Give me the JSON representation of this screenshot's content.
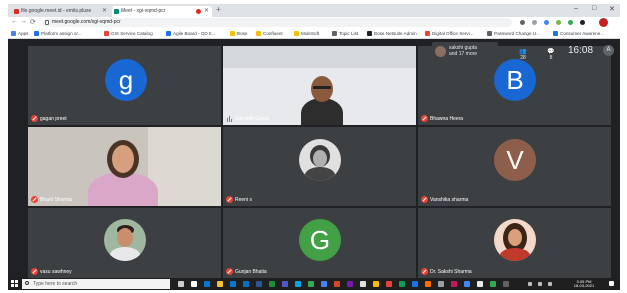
{
  "browser": {
    "tabs": [
      {
        "title": "file.google.meet.id - emits.pluse",
        "icon_color": "#d93025"
      },
      {
        "title": "Meet - xgi-vqmd-pcr",
        "icon_color": "#00897b"
      }
    ],
    "new_tab": "+",
    "window_controls": {
      "minimize": "–",
      "maximize": "□",
      "close": "✕"
    },
    "nav": {
      "back": "←",
      "forward": "→",
      "reload": "⟳"
    },
    "url": "meet.google.com/xgi-vqmd-pcr",
    "bookmarks": [
      "Apps",
      "Platform assign or...",
      "GIS Service Catalog",
      "Agile Board - GD II...",
      "Bose",
      "Confluent",
      "MuleSoft",
      "Topic List",
      "Bose Netsuite Admin",
      "Digital Office Servi...",
      "Password Change U...",
      "Consumer Awarene..."
    ]
  },
  "meet": {
    "presenter": {
      "name": "sakshi gupta",
      "subtitle": "and 17 more"
    },
    "participant_count": "28",
    "chat_count": "8",
    "time": "16:08",
    "self_initial": "A",
    "participants": [
      {
        "name": "gagan preet",
        "initial": "g",
        "avatar_color": "#1967d2",
        "muted": true
      },
      {
        "name": "Samarth Gupta",
        "muted": false
      },
      {
        "name": "Bhawna Heera",
        "initial": "B",
        "avatar_color": "#1967d2",
        "muted": true
      },
      {
        "name": "Bharti Sharma",
        "muted": true
      },
      {
        "name": "Reeni s",
        "muted": true
      },
      {
        "name": "Vanshika sharma",
        "initial": "V",
        "avatar_color": "#8d5e4a",
        "muted": true
      },
      {
        "name": "vasu sawhney",
        "muted": true
      },
      {
        "name": "Gunjan Bhatia",
        "initial": "G",
        "avatar_color": "#43a047",
        "muted": true
      },
      {
        "name": "Dr. Sakshi Sharma",
        "muted": true
      }
    ]
  },
  "taskbar": {
    "search_placeholder": "Type here to search",
    "time": "3:05 PM",
    "date": "18-03-2021"
  }
}
